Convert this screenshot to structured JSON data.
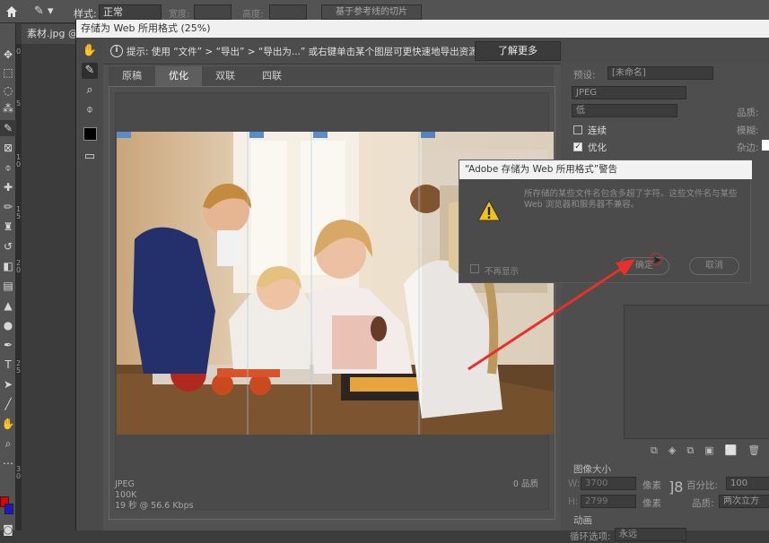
{
  "ps": {
    "style_label": "样式:",
    "style_value": "正常",
    "width_label": "宽度:",
    "height_label": "高度:",
    "slice_button": "基于参考线的切片",
    "doc_tab": "素材.jpg @",
    "ruler_marks": [
      "0",
      "5",
      "1",
      "0",
      "1",
      "5",
      "2",
      "0",
      "2",
      "5",
      "3",
      "0"
    ]
  },
  "dialog": {
    "title": "存储为 Web 所用格式 (25%)",
    "hint": "提示: 使用 “文件” > “导出” > “导出为...” 或右键单击某个图层可更快速地导出资源",
    "learn_more": "了解更多",
    "tabs": [
      "原稿",
      "优化",
      "双联",
      "四联"
    ],
    "active_tab": "优化",
    "info": {
      "format": "JPEG",
      "size": "100K",
      "time": "19 秒 @ 56.6 Kbps",
      "quality": "0 品质"
    }
  },
  "panel": {
    "preset_label": "预设:",
    "preset_value": "[未命名]",
    "format_value": "JPEG",
    "quality_select": "低",
    "quality_label": "品质:",
    "blur_label": "模糊:",
    "matte_label": "杂边:",
    "progressive": "连续",
    "optimized": "优化",
    "image_size_header": "图像大小",
    "w_label": "W:",
    "w_value": "3700",
    "h_label": "H:",
    "h_value": "2799",
    "px1": "像素",
    "px2": "像素",
    "percent_label": "百分比:",
    "percent_value": "100",
    "quality2_label": "品质:",
    "quality2_value": "两次立方",
    "anim_header": "动画",
    "loop_label": "循环选项:",
    "loop_value": "永远"
  },
  "warning": {
    "title": "“Adobe 存储为 Web 所用格式”警告",
    "message": "所存储的某些文件名包含多超了字符。这些文件名与某些 Web 浏览器和服务器不兼容。",
    "dont_show": "不再显示",
    "ok": "确定",
    "cancel": "取消"
  },
  "colors": {
    "foreground": "#e00000",
    "background": "#1a1ac8",
    "arrow": "#e8302a"
  }
}
